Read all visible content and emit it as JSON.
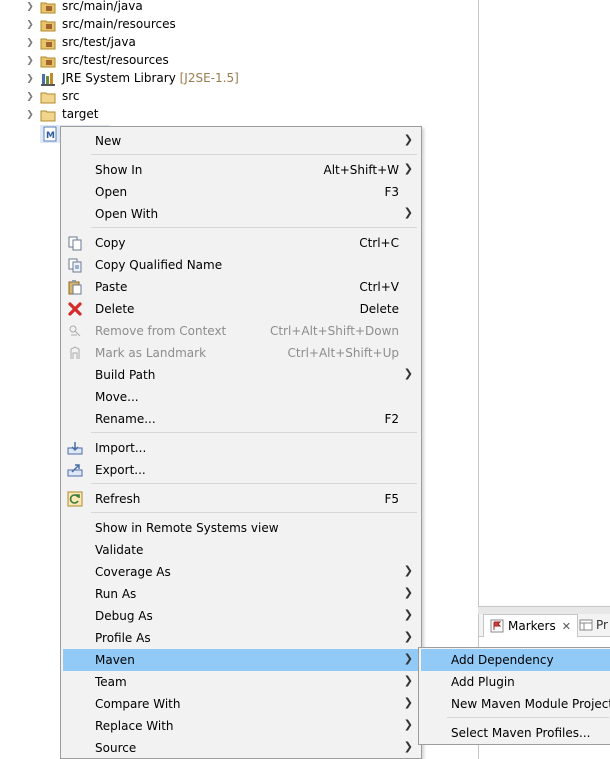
{
  "tree": {
    "items": [
      {
        "label": "src/main/java",
        "icon": "package-folder-icon"
      },
      {
        "label": "src/main/resources",
        "icon": "package-folder-icon"
      },
      {
        "label": "src/test/java",
        "icon": "package-folder-icon"
      },
      {
        "label": "src/test/resources",
        "icon": "package-folder-icon"
      },
      {
        "label": "JRE System Library",
        "decoration": "[J2SE-1.5]",
        "icon": "library-icon"
      },
      {
        "label": "src",
        "icon": "folder-icon"
      },
      {
        "label": "target",
        "icon": "folder-icon"
      },
      {
        "label": "",
        "icon": "maven-pom-icon"
      }
    ]
  },
  "views": {
    "markers_tab": "Markers",
    "other_tab": "Pr"
  },
  "context_menu": {
    "items": [
      {
        "label": "New",
        "shortcut": "",
        "submenu": true
      },
      {
        "label": "Show In",
        "shortcut": "Alt+Shift+W",
        "submenu": true
      },
      {
        "label": "Open",
        "shortcut": "F3",
        "submenu": false
      },
      {
        "label": "Open With",
        "shortcut": "",
        "submenu": true
      },
      {
        "label": "Copy",
        "shortcut": "Ctrl+C",
        "icon": "copy-icon"
      },
      {
        "label": "Copy Qualified Name",
        "shortcut": "",
        "icon": "copy-qualified-icon"
      },
      {
        "label": "Paste",
        "shortcut": "Ctrl+V",
        "icon": "paste-icon"
      },
      {
        "label": "Delete",
        "shortcut": "Delete",
        "icon": "delete-icon"
      },
      {
        "label": "Remove from Context",
        "shortcut": "Ctrl+Alt+Shift+Down",
        "disabled": true
      },
      {
        "label": "Mark as Landmark",
        "shortcut": "Ctrl+Alt+Shift+Up",
        "disabled": true
      },
      {
        "label": "Build Path",
        "shortcut": "",
        "submenu": true
      },
      {
        "label": "Move...",
        "shortcut": ""
      },
      {
        "label": "Rename...",
        "shortcut": "F2"
      },
      {
        "label": "Import...",
        "shortcut": "",
        "icon": "import-icon"
      },
      {
        "label": "Export...",
        "shortcut": "",
        "icon": "export-icon"
      },
      {
        "label": "Refresh",
        "shortcut": "F5",
        "icon": "refresh-icon"
      },
      {
        "label": "Show in Remote Systems view",
        "shortcut": ""
      },
      {
        "label": "Validate",
        "shortcut": ""
      },
      {
        "label": "Coverage As",
        "shortcut": "",
        "submenu": true
      },
      {
        "label": "Run As",
        "shortcut": "",
        "submenu": true
      },
      {
        "label": "Debug As",
        "shortcut": "",
        "submenu": true
      },
      {
        "label": "Profile As",
        "shortcut": "",
        "submenu": true
      },
      {
        "label": "Maven",
        "shortcut": "",
        "submenu": true,
        "highlighted": true
      },
      {
        "label": "Team",
        "shortcut": "",
        "submenu": true
      },
      {
        "label": "Compare With",
        "shortcut": "",
        "submenu": true
      },
      {
        "label": "Replace With",
        "shortcut": "",
        "submenu": true
      },
      {
        "label": "Source",
        "shortcut": "",
        "submenu": true
      }
    ],
    "highlight_color": "#91c9f7"
  },
  "maven_submenu": {
    "items": [
      {
        "label": "Add Dependency",
        "highlighted": true
      },
      {
        "label": "Add Plugin"
      },
      {
        "label": "New Maven Module Project"
      },
      {
        "label": "Select Maven Profiles..."
      }
    ]
  }
}
